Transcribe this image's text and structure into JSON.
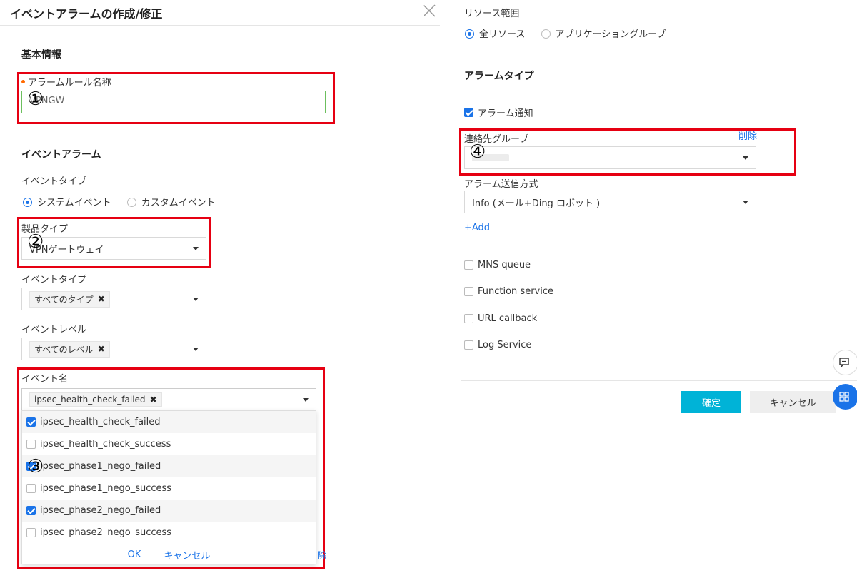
{
  "dialog": {
    "title": "イベントアラームの作成/修正"
  },
  "basic": {
    "section_title": "基本情報",
    "rule_name_label": "アラームルール名称",
    "rule_name_value": "VPNGW",
    "marker": "①"
  },
  "event_alarm": {
    "section_title": "イベントアラーム",
    "event_type_label": "イベントタイプ",
    "event_type_options": [
      "システムイベント",
      "カスタムイベント"
    ],
    "event_type_selected": "システムイベント",
    "product_type_label": "製品タイプ",
    "product_type_value": "VPNゲートウェイ",
    "marker_2": "②",
    "event_type2_label": "イベントタイプ",
    "event_type2_tag": "すべてのタイプ",
    "event_level_label": "イベントレベル",
    "event_level_tag": "すべてのレベル",
    "event_name_label": "イベント名",
    "event_name_tag": "ipsec_health_check_failed",
    "marker_3": "③",
    "event_names": [
      {
        "label": "ipsec_health_check_failed",
        "checked": true
      },
      {
        "label": "ipsec_health_check_success",
        "checked": false
      },
      {
        "label": "ipsec_phase1_nego_failed",
        "checked": true
      },
      {
        "label": "ipsec_phase1_nego_success",
        "checked": false
      },
      {
        "label": "ipsec_phase2_nego_failed",
        "checked": true
      },
      {
        "label": "ipsec_phase2_nego_success",
        "checked": false
      }
    ],
    "dropdown_ok": "OK",
    "dropdown_cancel": "キャンセル",
    "hidden_delete_fragment": "除"
  },
  "resource": {
    "label": "リソース範囲",
    "options": [
      "全リソース",
      "アプリケーショングループ"
    ],
    "selected": "全リソース"
  },
  "alarm_type": {
    "section_title": "アラームタイプ",
    "alarm_notify_label": "アラーム通知",
    "alarm_notify_checked": true,
    "contact_group_label": "連絡先グループ",
    "delete_label": "削除",
    "marker_4": "④",
    "send_method_label": "アラーム送信方式",
    "send_method_value": "Info (メール+Ding ロボット )",
    "add_label": "+Add",
    "others": [
      {
        "label": "MNS queue",
        "checked": false
      },
      {
        "label": "Function service",
        "checked": false
      },
      {
        "label": "URL callback",
        "checked": false
      },
      {
        "label": "Log Service",
        "checked": false
      }
    ]
  },
  "footer": {
    "confirm": "確定",
    "cancel": "キャンセル"
  },
  "colors": {
    "accent": "#1a73e8",
    "primary_button": "#00b3d7",
    "annotation_red": "#e60012",
    "required_dot": "#ff6a00"
  },
  "icons": {
    "close": "close-icon",
    "caret": "caret-down-icon",
    "feedback": "chat-icon",
    "apps": "grid-icon"
  }
}
